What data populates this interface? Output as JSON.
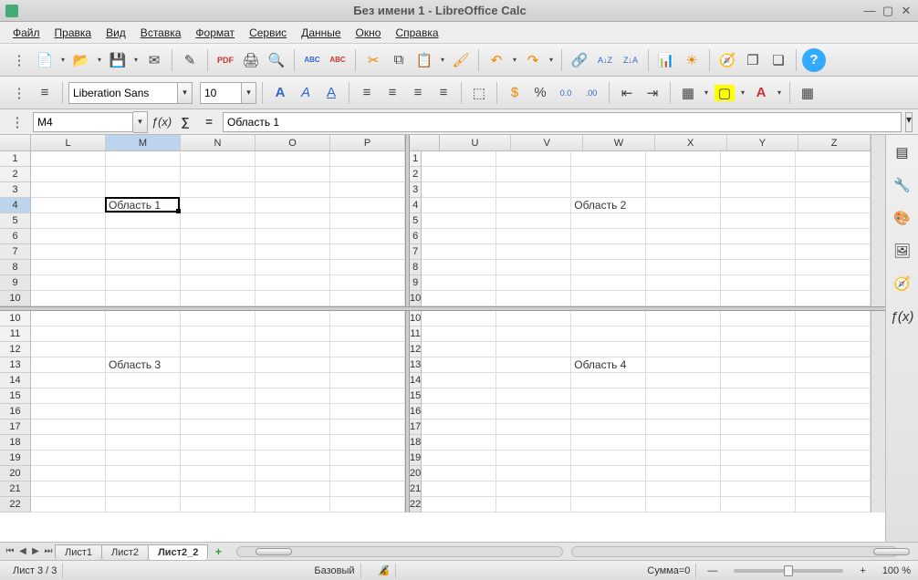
{
  "window": {
    "title": "Без имени 1 - LibreOffice Calc"
  },
  "menu": [
    "Файл",
    "Правка",
    "Вид",
    "Вставка",
    "Формат",
    "Сервис",
    "Данные",
    "Окно",
    "Справка"
  ],
  "format": {
    "font_name": "Liberation Sans",
    "font_size": "10"
  },
  "formula": {
    "cell_ref": "M4",
    "content": "Область 1"
  },
  "columns_left": [
    "L",
    "M",
    "N",
    "O",
    "P"
  ],
  "columns_right": [
    "U",
    "V",
    "W",
    "X",
    "Y",
    "Z"
  ],
  "rows_top": [
    "1",
    "2",
    "3",
    "4",
    "5",
    "6",
    "7",
    "8",
    "9",
    "10"
  ],
  "rows_bottom": [
    "10",
    "11",
    "12",
    "13",
    "14",
    "15",
    "16",
    "17",
    "18",
    "19",
    "20",
    "21",
    "22"
  ],
  "cells": {
    "M4": "Область 1",
    "W4": "Область 2",
    "M13": "Область 3",
    "W13": "Область 4"
  },
  "active_col": "M",
  "active_row": "4",
  "tabs": {
    "items": [
      "Лист1",
      "Лист2",
      "Лист2_2"
    ],
    "active": 2
  },
  "status": {
    "sheet": "Лист 3 / 3",
    "style": "Базовый",
    "sum": "Сумма=0",
    "zoom": "100 %"
  },
  "icons": {
    "new": "📄",
    "open": "📂",
    "save": "💾",
    "email": "✉",
    "edit": "✎",
    "pdf": "PDF",
    "print": "🖨",
    "preview": "🔍",
    "spellA": "ABC",
    "spellB": "ABC",
    "cut": "✂",
    "copy": "⧉",
    "paste": "📋",
    "fmtpaint": "🖌",
    "undo": "↶",
    "redo": "↷",
    "link": "🔗",
    "sortA": "A↓Z",
    "sortD": "Z↓A",
    "chart": "📊",
    "sun": "☀",
    "nav": "🧭",
    "gal1": "❐",
    "gal2": "❏",
    "help": "?",
    "styles": "≡",
    "bold": "A",
    "italic": "A",
    "under": "A",
    "alL": "≡",
    "alC": "≡",
    "alR": "≡",
    "alJ": "≡",
    "merge": "⬚",
    "curr": "$",
    "pct": "%",
    "dec1": "0.0",
    "dec2": ".00",
    "indL": "⇤",
    "indR": "⇥",
    "border": "▦",
    "bg": "▢",
    "fcol": "A",
    "grid": "▦",
    "fx": "ƒ(x)",
    "sum": "∑",
    "eq": "=",
    "sb_menu": "▤",
    "sb_prop": "🔧",
    "sb_style": "🎨",
    "sb_gal": "🖼",
    "sb_nav": "🧭",
    "sb_fx": "ƒ(x)"
  }
}
